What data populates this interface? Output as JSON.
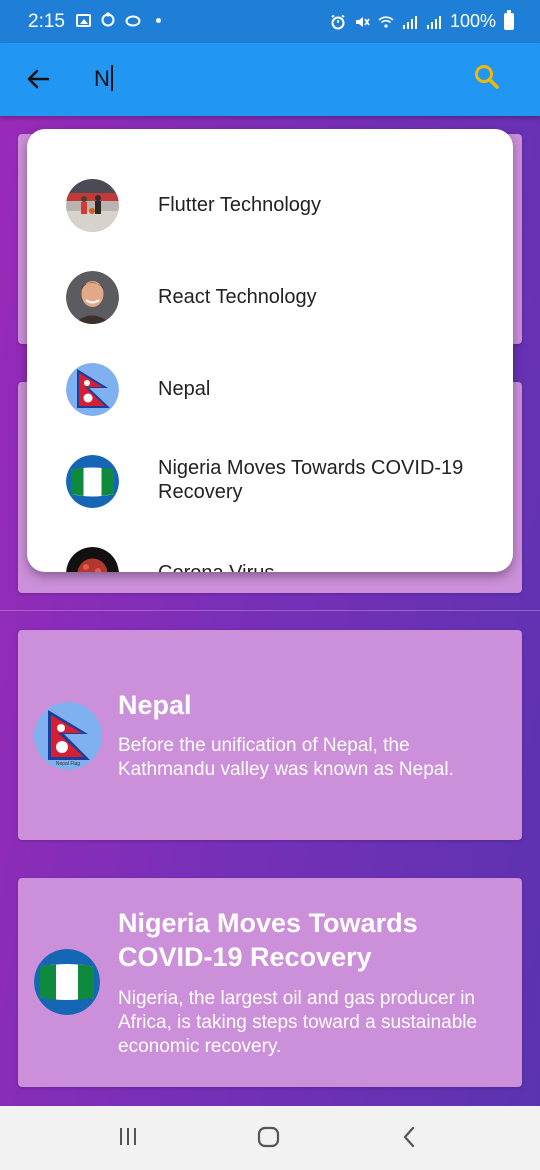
{
  "status_bar": {
    "time": "2:15",
    "battery": "100%"
  },
  "app_bar": {
    "search_value": "N",
    "icons": [
      "arrow-back-icon",
      "search-icon"
    ],
    "accent_color": "#2196f3",
    "search_icon_color": "#f5b800"
  },
  "suggestions": [
    {
      "label": "Flutter Technology",
      "avatar": "basketball-photo"
    },
    {
      "label": "React Technology",
      "avatar": "person-photo"
    },
    {
      "label": "Nepal",
      "avatar": "nepal-flag"
    },
    {
      "label": "Nigeria Moves Towards COVID-19 Recovery",
      "avatar": "nigeria-flag"
    },
    {
      "label": "Corona Virus",
      "avatar": "virus-image"
    }
  ],
  "cards": [
    {
      "title": "Nepal",
      "description": "Before the unification of Nepal, the Kathmandu valley was known as Nepal.",
      "avatar": "nepal-flag"
    },
    {
      "title": "Nigeria Moves Towards COVID-19 Recovery",
      "description": "Nigeria, the largest oil and gas producer in Africa, is taking steps toward a sustainable economic recovery.",
      "avatar": "nigeria-flag"
    }
  ],
  "colors": {
    "card_bg": "#cc8fd9",
    "background_start": "#9b2ab8",
    "background_end": "#5a33b0"
  }
}
